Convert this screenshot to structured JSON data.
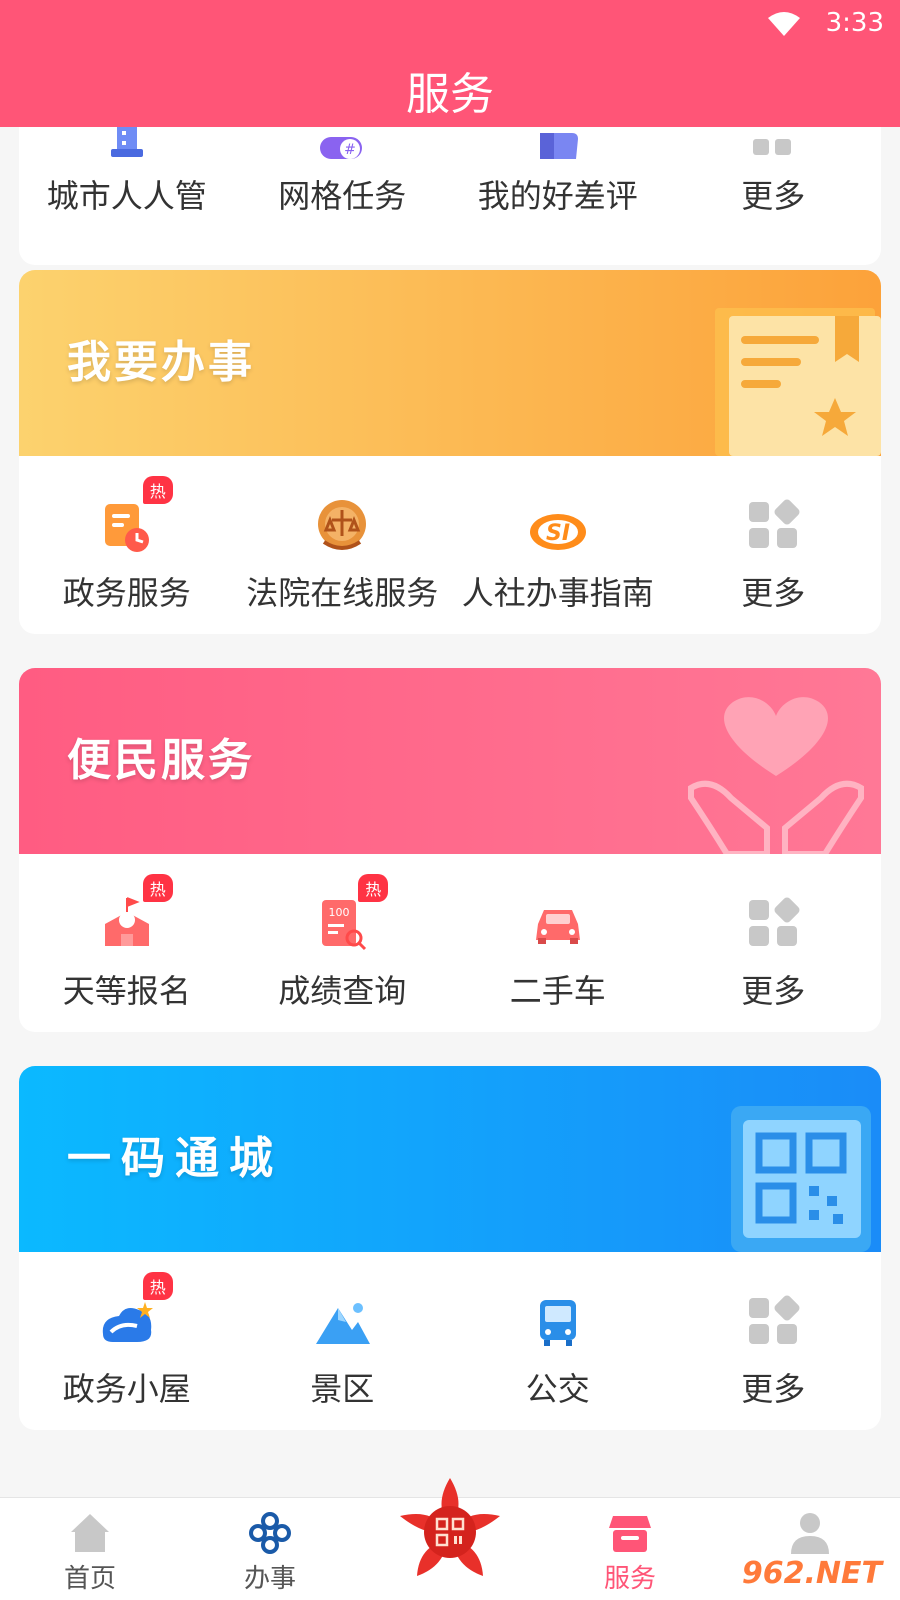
{
  "status_bar": {
    "time": "3:33"
  },
  "header": {
    "title": "服务"
  },
  "top_section": {
    "items": [
      {
        "label": "城市人人管"
      },
      {
        "label": "网格任务"
      },
      {
        "label": "我的好差评"
      },
      {
        "label": "更多"
      }
    ]
  },
  "sections": [
    {
      "title": "我要办事",
      "items": [
        {
          "label": "政务服务",
          "badge": "热"
        },
        {
          "label": "法院在线服务"
        },
        {
          "label": "人社办事指南"
        },
        {
          "label": "更多"
        }
      ]
    },
    {
      "title": "便民服务",
      "items": [
        {
          "label": "天等报名",
          "badge": "热"
        },
        {
          "label": "成绩查询",
          "badge": "热"
        },
        {
          "label": "二手车"
        },
        {
          "label": "更多"
        }
      ]
    },
    {
      "title": "一码通城",
      "items": [
        {
          "label": "政务小屋",
          "badge": "热"
        },
        {
          "label": "景区"
        },
        {
          "label": "公交"
        },
        {
          "label": "更多"
        }
      ]
    }
  ],
  "tabbar": {
    "home": "首页",
    "affairs": "办事",
    "service": "服务",
    "active": "服务"
  },
  "watermark": "962.NET",
  "colors": {
    "primary": "#ff5577",
    "banner1_start": "#fcd06c",
    "banner1_end": "#fca63a",
    "banner2_start": "#ff5c80",
    "banner2_end": "#ff7a96",
    "banner3_start": "#0db8ff",
    "banner3_end": "#1a8cf8"
  }
}
